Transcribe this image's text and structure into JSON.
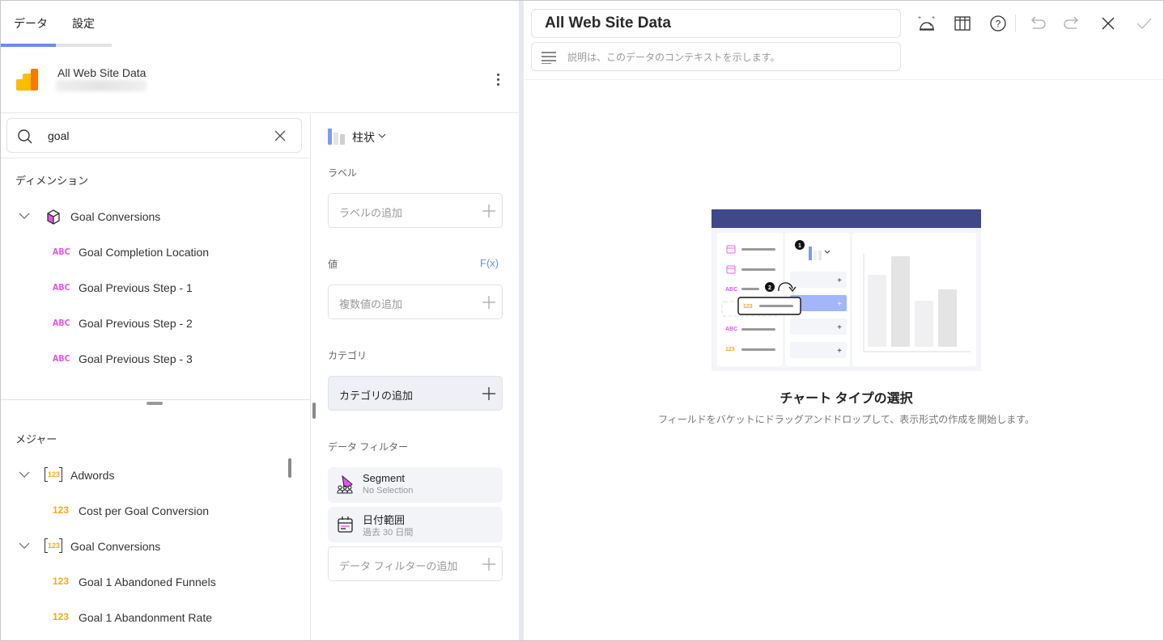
{
  "tabs": [
    {
      "label": "データ",
      "active": true
    },
    {
      "label": "設定",
      "active": false
    }
  ],
  "datasource": {
    "name": "All Web Site Data",
    "subtitle_blurred": true
  },
  "search": {
    "value": "goal",
    "placeholder": ""
  },
  "dimensions": {
    "label": "ディメンション",
    "groups": [
      {
        "label": "Goal Conversions",
        "icon": "cube-icon",
        "expanded": true,
        "items": [
          {
            "type": "ABC",
            "label": "Goal Completion Location"
          },
          {
            "type": "ABC",
            "label": "Goal Previous Step - 1"
          },
          {
            "type": "ABC",
            "label": "Goal Previous Step - 2"
          },
          {
            "type": "ABC",
            "label": "Goal Previous Step - 3"
          }
        ]
      }
    ]
  },
  "measures": {
    "label": "メジャー",
    "groups": [
      {
        "label": "Adwords",
        "icon": "123",
        "expanded": true,
        "items": [
          {
            "type": "123",
            "label": "Cost per Goal Conversion"
          }
        ]
      },
      {
        "label": "Goal Conversions",
        "icon": "123",
        "expanded": true,
        "items": [
          {
            "type": "123",
            "label": "Goal 1 Abandoned Funnels"
          },
          {
            "type": "123",
            "label": "Goal 1 Abandonment Rate"
          }
        ]
      }
    ]
  },
  "visualization": {
    "type_label": "柱状",
    "label_section": "ラベル",
    "label_add": "ラベルの追加",
    "values_section": "値",
    "fx_label": "F(x)",
    "values_add": "複数値の追加",
    "category_section": "カテゴリ",
    "category_add": "カテゴリの追加",
    "filters_section": "データ フィルター",
    "filters": [
      {
        "title": "Segment",
        "subtitle": "No Selection",
        "icon": "segment-icon"
      },
      {
        "title": "日付範囲",
        "subtitle": "過去 30 日間",
        "icon": "calendar-icon"
      }
    ],
    "filter_add": "データ フィルターの追加"
  },
  "editor": {
    "title": "All Web Site Data",
    "description_placeholder": "説明は、このデータのコンテキストを示します。",
    "toolbar": [
      "ai-insights-icon",
      "table-icon",
      "help-icon",
      "undo-icon",
      "redo-icon",
      "close-icon",
      "check-icon"
    ]
  },
  "empty_state": {
    "title": "チャート タイプの選択",
    "subtitle": "フィールドをバケットにドラッグアンドドロップして、表示形式の作成を開始します。",
    "illustration": {
      "step1": "1",
      "step2": "2",
      "abc": "ABC",
      "num": "123"
    }
  },
  "colors": {
    "accent": "#6b8cea",
    "dimension_type": "#e851ef",
    "measure_type": "#f7a81c",
    "illustration_header": "#3f4889"
  }
}
